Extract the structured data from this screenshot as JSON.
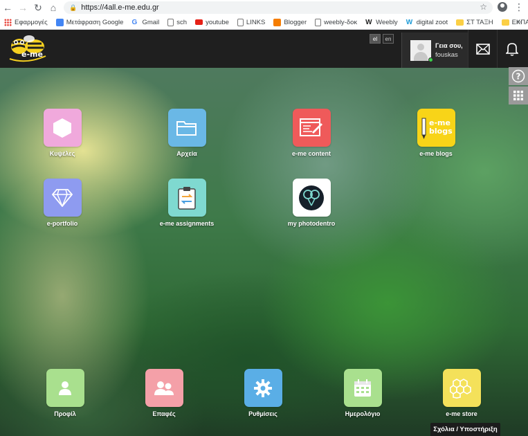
{
  "browser": {
    "url": "https://4all.e-me.edu.gr",
    "bookmarks": [
      {
        "label": "Εφαρμογές",
        "icon": "apps-grid-icon",
        "color": "#e8453c"
      },
      {
        "label": "Μετάφραση Google",
        "icon": "translate-icon",
        "color": "#4285f4"
      },
      {
        "label": "Gmail",
        "icon": "google-g-icon",
        "color": "#4285f4"
      },
      {
        "label": "sch",
        "icon": "page-icon",
        "color": "#ffffff"
      },
      {
        "label": "youtube",
        "icon": "youtube-icon",
        "color": "#e62117"
      },
      {
        "label": "LINKS",
        "icon": "page-icon",
        "color": "#ffffff"
      },
      {
        "label": "Blogger",
        "icon": "blogger-icon",
        "color": "#f57d00"
      },
      {
        "label": "weebly-δοκ",
        "icon": "page-icon",
        "color": "#ffffff"
      },
      {
        "label": "Weebly",
        "icon": "weebly-icon",
        "color": "#222222"
      },
      {
        "label": "digital zoot",
        "icon": "weebly-icon",
        "color": "#1c9ad6"
      },
      {
        "label": "ΣΤ ΤΑΞΗ",
        "icon": "folder-icon",
        "color": "#fbcf45"
      },
      {
        "label": "ΕΚΠΑΙΔΕΥΣΗ",
        "icon": "folder-icon",
        "color": "#fbcf45"
      }
    ],
    "more": "»"
  },
  "header": {
    "logo_text": "e-me",
    "lang_el": "el",
    "lang_en": "en",
    "greeting": "Γεια σου,",
    "username": "fouskas"
  },
  "apps": [
    {
      "label": "Κυψέλες",
      "icon": "hexagon-icon",
      "color": "#f0a9dc"
    },
    {
      "label": "Αρχεία",
      "icon": "folder-icon",
      "color": "#6ab8e6"
    },
    {
      "label": "e-me content",
      "icon": "content-editor-icon",
      "color": "#ef5a5a"
    },
    {
      "label": "e-me blogs",
      "icon": "blogs-icon",
      "color": "#f8d418"
    },
    {
      "label": "e-portfolio",
      "icon": "diamond-icon",
      "color": "#8e9bf0"
    },
    {
      "label": "e-me assignments",
      "icon": "clipboard-icon",
      "color": "#7fd9d0"
    },
    {
      "label": "my photodentro",
      "icon": "photodentro-icon",
      "color": "#ffffff"
    }
  ],
  "dock": [
    {
      "label": "Προφίλ",
      "icon": "user-icon",
      "color": "#a9e08e"
    },
    {
      "label": "Επαφές",
      "icon": "contacts-icon",
      "color": "#f4a0a8"
    },
    {
      "label": "Ρυθμίσεις",
      "icon": "gear-icon",
      "color": "#5aaee6"
    },
    {
      "label": "Ημερολόγιο",
      "icon": "calendar-icon",
      "color": "#a9e08e"
    },
    {
      "label": "e-me store",
      "icon": "store-icon",
      "color": "#f4e15a"
    }
  ],
  "blogs_icon_text": "e-me\nblogs",
  "support_label": "Σχόλια / Υποστήριξη"
}
